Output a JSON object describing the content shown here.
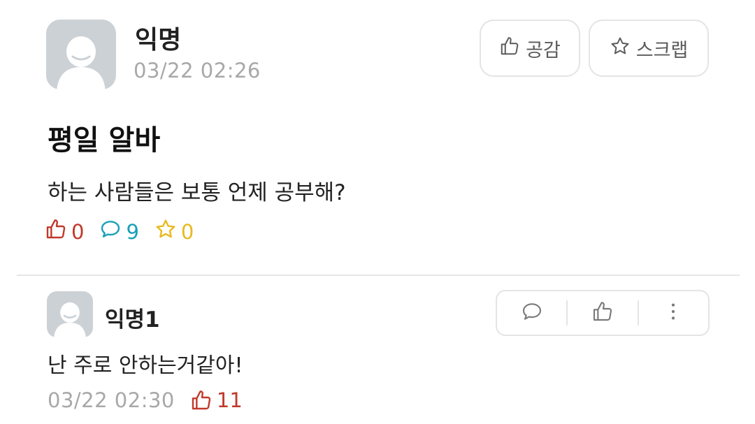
{
  "post": {
    "author": "익명",
    "time": "03/22 02:26",
    "title": "평일 알바",
    "body": "하는 사람들은 보통 언제 공부해?",
    "like_count": "0",
    "comment_count": "9",
    "scrap_count": "0"
  },
  "actions": {
    "like_label": "공감",
    "scrap_label": "스크랩"
  },
  "comment": {
    "author": "익명1",
    "body": "난 주로 안하는거같아!",
    "time": "03/22 02:30",
    "like_count": "11"
  },
  "colors": {
    "like": "#c0392b",
    "comment": "#1aa0b8",
    "scrap": "#e8b920",
    "muted": "#a8a8a8",
    "avatar_bg": "#ccd1d6"
  },
  "icons": {
    "thumb": "thumbs-up-icon",
    "bubble": "speech-bubble-icon",
    "star": "star-icon",
    "more": "more-vertical-icon"
  }
}
